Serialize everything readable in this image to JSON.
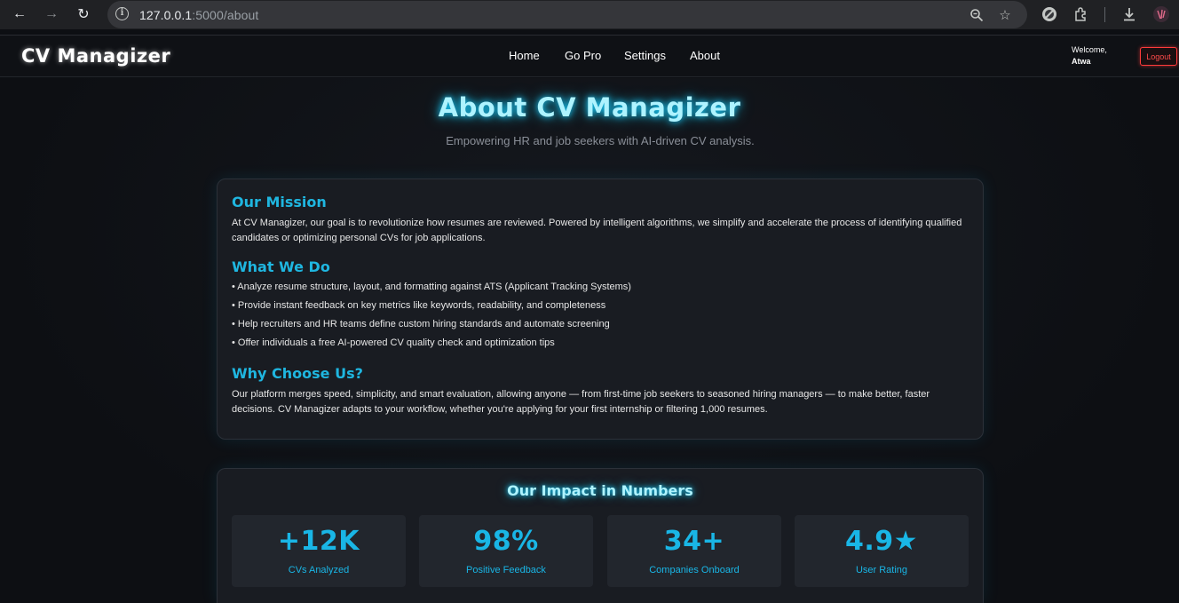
{
  "browser": {
    "url_host": "127.0.0.1",
    "url_path": ":5000/about"
  },
  "navbar": {
    "logo": "CV Managizer",
    "links": [
      "Home",
      "Go Pro",
      "Settings",
      "About"
    ],
    "welcome_label": "Welcome,",
    "username": "Atwa",
    "logout_label": "Logout"
  },
  "hero": {
    "title": "About CV Managizer",
    "subtitle": "Empowering HR and job seekers with AI-driven CV analysis."
  },
  "about": {
    "mission_heading": "Our Mission",
    "mission_text": "At CV Managizer, our goal is to revolutionize how resumes are reviewed. Powered by intelligent algorithms, we simplify and accelerate the process of identifying qualified candidates or optimizing personal CVs for job applications.",
    "what_heading": "What We Do",
    "what_items": [
      "• Analyze resume structure, layout, and formatting against ATS (Applicant Tracking Systems)",
      "• Provide instant feedback on key metrics like keywords, readability, and completeness",
      "• Help recruiters and HR teams define custom hiring standards and automate screening",
      "• Offer individuals a free AI-powered CV quality check and optimization tips"
    ],
    "why_heading": "Why Choose Us?",
    "why_text": "Our platform merges speed, simplicity, and smart evaluation, allowing anyone — from first-time job seekers to seasoned hiring managers — to make better, faster decisions. CV Managizer adapts to your workflow, whether you're applying for your first internship or filtering 1,000 resumes."
  },
  "impact": {
    "title": "Our Impact in Numbers",
    "stats": [
      {
        "value": "+12K",
        "label": "CVs Analyzed"
      },
      {
        "value": "98%",
        "label": "Positive Feedback"
      },
      {
        "value": "34+",
        "label": "Companies Onboard"
      },
      {
        "value": "4.9★",
        "label": "User Rating"
      }
    ]
  },
  "colors": {
    "accent": "#19b6e6",
    "glow": "#18d0ff",
    "logout": "#ff4a4a",
    "background": "#0d0f13",
    "card": "#191c22"
  }
}
